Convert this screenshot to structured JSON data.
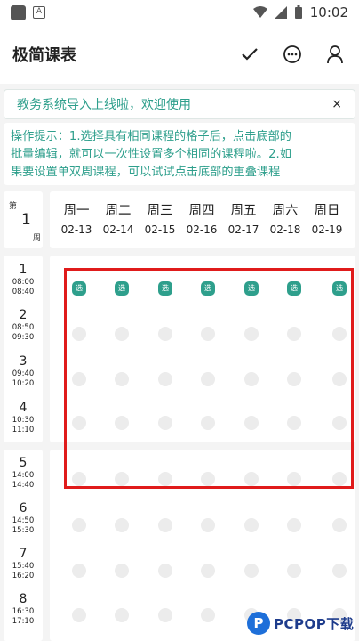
{
  "status_bar": {
    "time": "10:02",
    "icons": [
      "notification-square-icon",
      "a-icon",
      "wifi-icon",
      "signal-icon",
      "battery-icon"
    ]
  },
  "app_bar": {
    "title": "极简课表",
    "actions": [
      "check-icon",
      "chat-icon",
      "user-icon"
    ]
  },
  "notice": {
    "text": "教务系统导入上线啦，欢迎使用",
    "close": "×"
  },
  "tip": {
    "line1": "操作提示：1.选择具有相同课程的格子后，点击底部的",
    "line2": "批量编辑，就可以一次性设置多个相同的课程啦。2.如",
    "line3": "果要设置单双周课程，可以试试点击底部的重叠课程"
  },
  "week": {
    "prefix": "第",
    "number": "1",
    "suffix": "周"
  },
  "days": [
    {
      "name": "周一",
      "date": "02-13"
    },
    {
      "name": "周二",
      "date": "02-14"
    },
    {
      "name": "周三",
      "date": "02-15"
    },
    {
      "name": "周四",
      "date": "02-16"
    },
    {
      "name": "周五",
      "date": "02-17"
    },
    {
      "name": "周六",
      "date": "02-18"
    },
    {
      "name": "周日",
      "date": "02-19"
    }
  ],
  "periods": [
    {
      "num": "1",
      "start": "08:00",
      "end": "08:40"
    },
    {
      "num": "2",
      "start": "08:50",
      "end": "09:30"
    },
    {
      "num": "3",
      "start": "09:40",
      "end": "10:20"
    },
    {
      "num": "4",
      "start": "10:30",
      "end": "11:10"
    },
    {
      "num": "5",
      "start": "14:00",
      "end": "14:40"
    },
    {
      "num": "6",
      "start": "14:50",
      "end": "15:30"
    },
    {
      "num": "7",
      "start": "15:40",
      "end": "16:20"
    },
    {
      "num": "8",
      "start": "16:30",
      "end": "17:10"
    }
  ],
  "selected_label": "选",
  "watermark": {
    "logo": "P",
    "text": "PCPOP下载"
  },
  "colors": {
    "accent": "#2e9f8c",
    "highlight": "#e01b1b",
    "slot": "#ececec"
  }
}
